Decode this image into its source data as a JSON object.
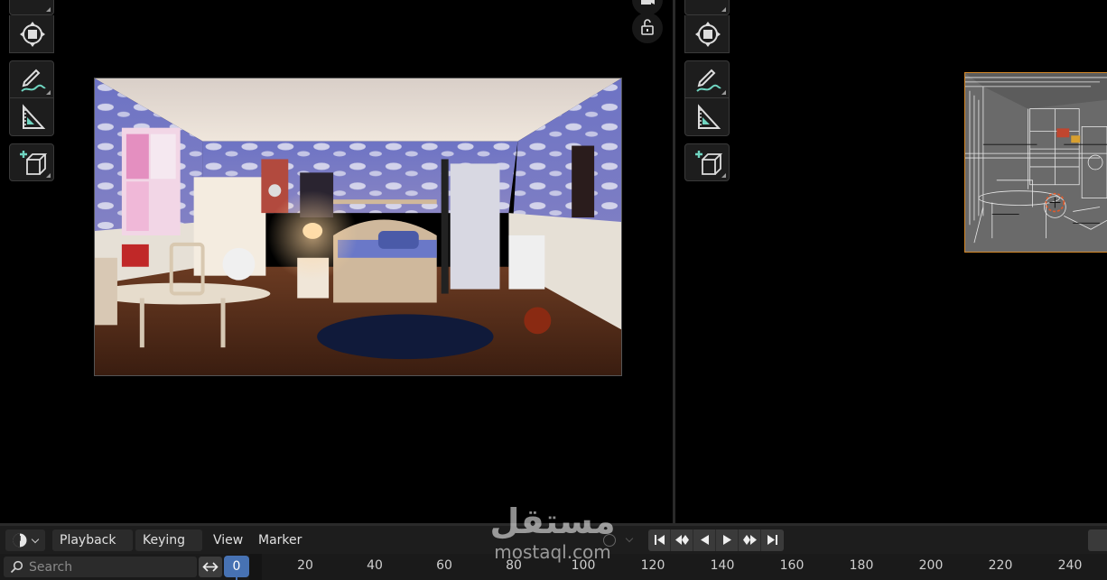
{
  "timeline": {
    "editor_type_icon": "clock-icon",
    "menus": [
      {
        "label": "Playback",
        "dropdown": true
      },
      {
        "label": "Keying",
        "dropdown": true
      },
      {
        "label": "View",
        "dropdown": false
      },
      {
        "label": "Marker",
        "dropdown": false
      }
    ],
    "playback_controls": [
      "jump-to-start-icon",
      "jump-to-keyframe-prev-icon",
      "play-reverse-icon",
      "play-icon",
      "jump-to-keyframe-next-icon",
      "jump-to-end-icon"
    ],
    "search_placeholder": "Search",
    "current_frame": "0",
    "frame_ticks": [
      "20",
      "40",
      "60",
      "80",
      "100",
      "120",
      "140",
      "160",
      "180",
      "200",
      "220",
      "240"
    ]
  },
  "viewport_left": {
    "tools": [
      "transform-icon",
      "transform-pivot-icon",
      "annotate-icon",
      "measure-icon",
      "add-cube-icon"
    ],
    "gizmos": [
      "camera-icon",
      "lock-icon"
    ],
    "render_preview": "rendered-bedroom-scene"
  },
  "viewport_right": {
    "tools": [
      "transform-icon",
      "transform-pivot-icon",
      "annotate-icon",
      "measure-icon",
      "add-cube-icon"
    ],
    "wireframe_preview": "wireframe-bedroom-scene"
  },
  "watermark": {
    "arabic": "مستقل",
    "latin": "mostaql.com"
  },
  "colors": {
    "accent_blue": "#4772b3",
    "selection_orange": "#d68a2a",
    "panel": "#1d1d1d"
  }
}
